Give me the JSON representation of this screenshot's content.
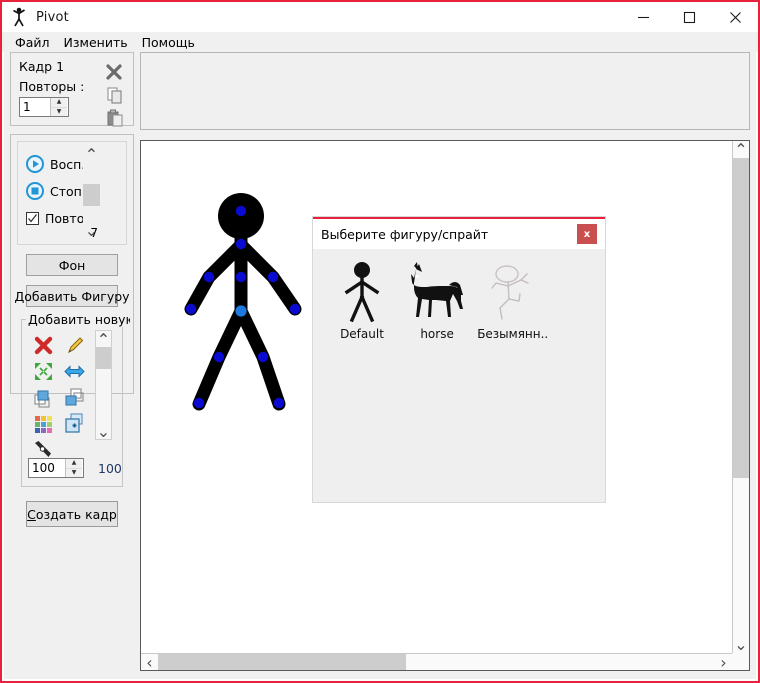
{
  "window": {
    "title": "Pivot",
    "app_icon": "stickman-icon",
    "border_color": "#e8213c",
    "minimize_label": "—",
    "maximize_label": "□",
    "close_label": "✕"
  },
  "menubar": {
    "items": [
      {
        "label": "Файл",
        "name": "menu-file"
      },
      {
        "label": "Изменить",
        "name": "menu-edit"
      },
      {
        "label": "Помощь",
        "name": "menu-help"
      }
    ]
  },
  "frame_panel": {
    "frame_label": "Кадр 1",
    "repeat_label": "Повторы :",
    "repeat_value": "1",
    "delete_icon": "delete-x-icon",
    "copy_icon": "copy-icon",
    "paste_icon": "paste-icon"
  },
  "playback": {
    "play_label": "Восп.",
    "play_icon": "play-circle-icon",
    "stop_label": "Стоп",
    "stop_icon": "stop-circle-icon",
    "loop_label": "Повтор",
    "loop_checked": true,
    "speed_value": "7"
  },
  "buttons": {
    "background_label": "Фон",
    "add_figure_label": "Добавить Фигуру",
    "create_frame_accel": "С",
    "create_frame_rest": "оздать кадр"
  },
  "sprite_tools": {
    "group_title": "Добавить новую с",
    "icons": [
      {
        "name": "delete-x-icon"
      },
      {
        "name": "edit-pencil-icon"
      },
      {
        "name": "resize-arrows-icon"
      },
      {
        "name": "flip-horizontal-icon"
      },
      {
        "name": "send-to-back-icon"
      },
      {
        "name": "bring-to-front-icon"
      },
      {
        "name": "color-palette-icon"
      },
      {
        "name": "duplicate-add-icon"
      },
      {
        "name": "pen-tool-icon"
      }
    ],
    "scale_value": "100",
    "scale_readout": "100",
    "scale_readout_color": "#1f3a68"
  },
  "canvas": {
    "figure_name": "stick-figure",
    "joint_color": "#0a0ad0",
    "center_joint_color": "#1f7ae0",
    "limb_color": "#000000"
  },
  "sprite_dialog": {
    "title": "Выберите фигуру/спрайт",
    "close_label": "x",
    "close_color": "#c9504f",
    "accent_color": "#e8213c",
    "sprites": [
      {
        "name": "Default",
        "art": "stickman-black"
      },
      {
        "name": "horse",
        "art": "horse-black"
      },
      {
        "name": "Безымянн..",
        "art": "stickman-gray"
      }
    ]
  },
  "scrollbars": {
    "up_glyph": "⌃",
    "down_glyph": "⌄",
    "left_glyph": "‹",
    "right_glyph": "›"
  }
}
